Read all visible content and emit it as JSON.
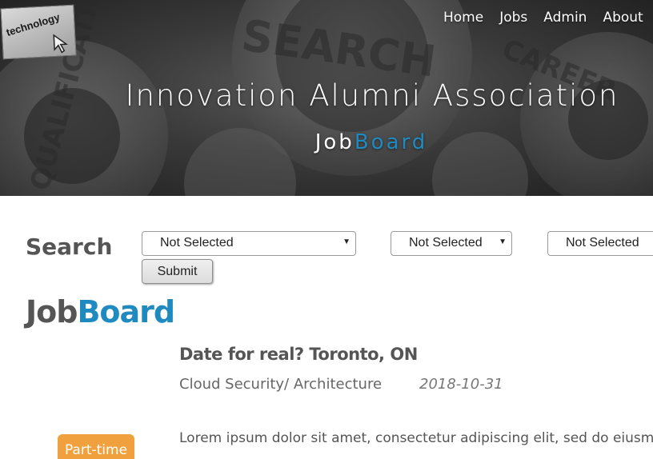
{
  "hero": {
    "logo_text": "technology",
    "nav": [
      "Home",
      "Jobs",
      "Admin",
      "About"
    ],
    "title": "Innovation Alumni Association",
    "subtitle_part1": "Job",
    "subtitle_part2": "Board",
    "gear_words": [
      "SEARCH",
      "CAREER",
      "QUALIFICATION"
    ]
  },
  "search": {
    "label": "Search",
    "selects": [
      "Not Selected",
      "Not Selected",
      "Not Selected"
    ],
    "submit_label": "Submit"
  },
  "board": {
    "heading_part1": "Job",
    "heading_part2": "Board",
    "jobs": [
      {
        "title": "Date for real? Toronto, ON",
        "category": "Cloud Security/ Architecture",
        "date": "2018-10-31",
        "type": "Part-time",
        "description": "Lorem ipsum dolor sit amet, consectetur adipiscing elit, sed do eiusm"
      }
    ]
  },
  "colors": {
    "accent": "#1f8ac0",
    "badge": "#f0a03c",
    "text": "#555555"
  }
}
